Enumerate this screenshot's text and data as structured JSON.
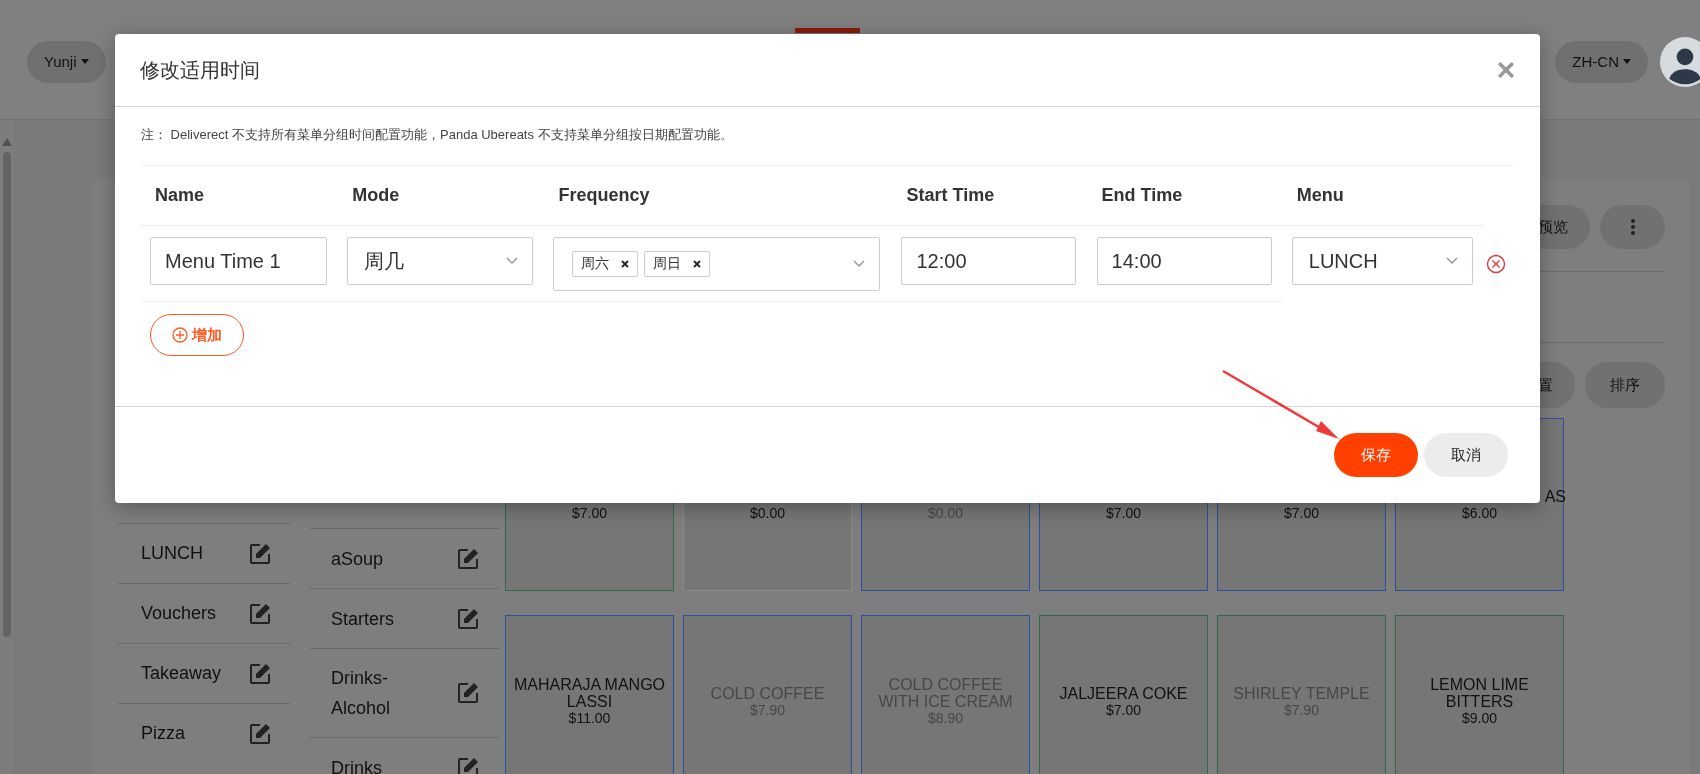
{
  "header": {
    "account": "Yunji",
    "language": "ZH-CN"
  },
  "toolbar": {
    "preview_button": "预览",
    "settings_button": "置",
    "sort_button": "排序"
  },
  "categories": [
    "LUNCH",
    "Vouchers",
    "Takeaway",
    "Pizza"
  ],
  "items": [
    "aSoup",
    "Starters",
    "Drinks-Alcohol",
    "Drinks"
  ],
  "products": [
    {
      "price": "$7.00",
      "disabled": false,
      "color": "#2f6b47"
    },
    {
      "price": "$0.00",
      "disabled": false,
      "color": "#8a8a8a"
    },
    {
      "price": "$0.00",
      "disabled": true,
      "color": "#2d4f9c"
    },
    {
      "price": "$7.00",
      "disabled": false,
      "color": "#2d4f9c"
    },
    {
      "price": "$7.00",
      "disabled": false,
      "color": "#2d4f9c"
    },
    {
      "name": "AS",
      "price": "$6.00",
      "disabled": false,
      "color": "#2d4f9c"
    },
    {
      "name": "MAHARAJA MANGO LASSI",
      "price": "$11.00",
      "disabled": false,
      "color": "#2d4f9c"
    },
    {
      "name": "COLD COFFEE",
      "price": "$7.90",
      "disabled": true,
      "color": "#2d4f9c"
    },
    {
      "name": "COLD COFFEE WITH ICE CREAM",
      "price": "$8.90",
      "disabled": true,
      "color": "#2d4f9c"
    },
    {
      "name": "JALJEERA COKE",
      "price": "$7.00",
      "disabled": false,
      "color": "#2f6b47"
    },
    {
      "name": "SHIRLEY TEMPLE",
      "price": "$7.90",
      "disabled": true,
      "color": "#2f6b47"
    },
    {
      "name": "LEMON LIME BITTERS",
      "price": "$9.00",
      "disabled": false,
      "color": "#2f6b47"
    }
  ],
  "dialog": {
    "title": "修改适用时间",
    "note": "注： Deliverect 不支持所有菜单分组时间配置功能，Panda Ubereats 不支持菜单分组按日期配置功能。",
    "columns": [
      "Name",
      "Mode",
      "Frequency",
      "Start Time",
      "End Time",
      "Menu"
    ],
    "rows": [
      {
        "name": "Menu Time 1",
        "mode": "周几",
        "frequency": [
          "周六",
          "周日"
        ],
        "start_time": "12:00",
        "end_time": "14:00",
        "menu": "LUNCH"
      }
    ],
    "add_button": "增加",
    "save_button": "保存",
    "cancel_button": "取消"
  }
}
